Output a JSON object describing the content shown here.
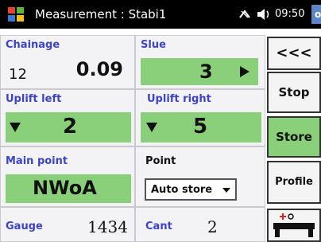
{
  "titlebar": {
    "title": "Measurement : Stabi1",
    "time": "09:50",
    "ok": "ok"
  },
  "chainage": {
    "label": "Chainage",
    "prefix": "12",
    "value": "0.09"
  },
  "slue": {
    "label": "Slue",
    "value": "3"
  },
  "uplift_left": {
    "label": "Uplift left",
    "value": "2"
  },
  "uplift_right": {
    "label": "Uplift right",
    "value": "5"
  },
  "main_point": {
    "label": "Main point",
    "value": "NWoA"
  },
  "point": {
    "label": "Point",
    "selected": "Auto store"
  },
  "gauge": {
    "label": "Gauge",
    "value": "1434"
  },
  "cant": {
    "label": "Cant",
    "value": "2"
  },
  "buttons": {
    "back": "<<<",
    "stop": "Stop",
    "store": "Store",
    "profile": "Profile"
  },
  "colors": {
    "accent_green": "#8ad07a",
    "label_blue": "#3d44c4"
  },
  "icons": [
    "windows-logo-icon",
    "connection-icon",
    "volume-icon",
    "play-right-icon",
    "arrow-down-icon",
    "rail-profile-icon"
  ]
}
